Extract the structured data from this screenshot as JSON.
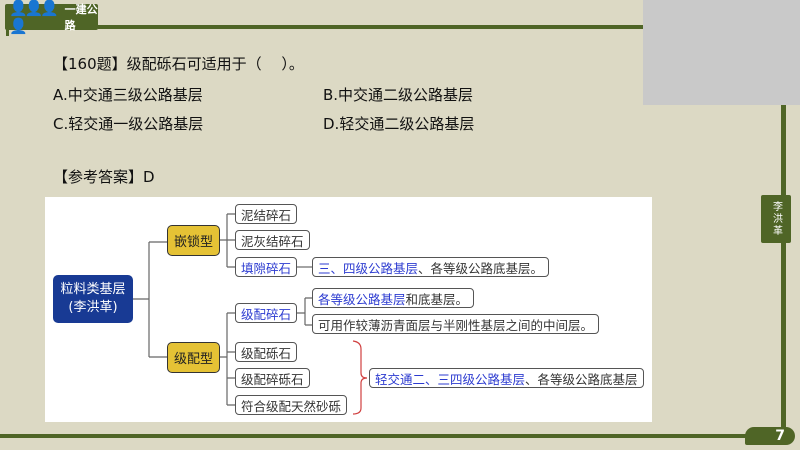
{
  "header": {
    "title": "一建公路"
  },
  "sidebar_tag": {
    "text": "李洪革"
  },
  "page_number": "7",
  "question": {
    "stem": "【160题】级配砾石可适用于（　 ）。",
    "options": [
      "A.中交通三级公路基层",
      "B.中交通二级公路基层",
      "C.轻交通一级公路基层",
      "D.轻交通二级公路基层"
    ],
    "answer": "【参考答案】D"
  },
  "diagram": {
    "root": {
      "line1": "粒料类基层",
      "line2": "(李洪革)"
    },
    "types": [
      "嵌锁型",
      "级配型"
    ],
    "interlock": [
      "泥结碎石",
      "泥灰结碎石",
      "填隙碎石"
    ],
    "graded": [
      "级配碎石",
      "级配砾石",
      "级配碎砾石",
      "符合级配天然砂砾"
    ],
    "fill_note": {
      "blue": "三、四级公路基层",
      "rest": "、各等级公路底基层。"
    },
    "graded_stone_notes": [
      {
        "blue": "各等级公路基层",
        "rest": "和底基层。"
      },
      {
        "blue": "",
        "rest": "可用作较薄沥青面层与半刚性基层之间的中间层。"
      }
    ],
    "gravel_note": {
      "blue": "轻交通二、三四级公路基层",
      "rest": "、各等级公路底基层"
    }
  },
  "colors": {
    "frame": "#4f6526",
    "background": "#dcd9c4",
    "root": "#183a94",
    "type": "#e5c235",
    "highlight": "#2c3bd0",
    "brace": "#d04040"
  }
}
